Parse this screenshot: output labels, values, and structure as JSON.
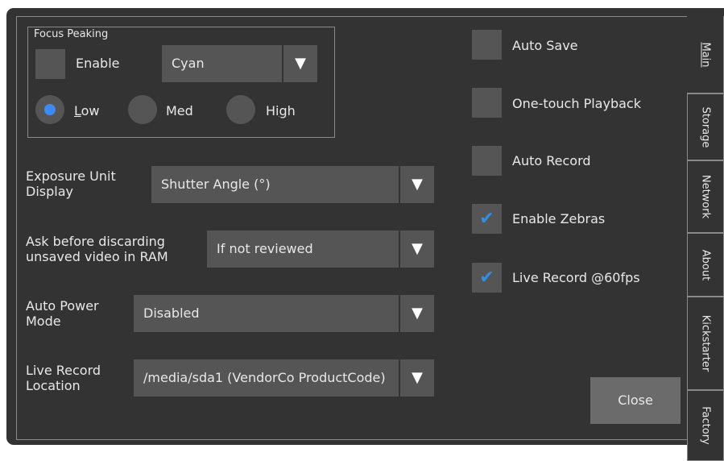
{
  "focus_peaking": {
    "title": "Focus Peaking",
    "enable_label": "Enable",
    "color_value": "Cyan",
    "radio_low_prefix": "",
    "radio_low_underlined": "L",
    "radio_low_rest": "ow",
    "radio_med": "Med",
    "radio_high_prefix": "Hi",
    "radio_high_underlined": "g",
    "radio_high_rest": "h",
    "selected": "Low"
  },
  "settings": {
    "exposure_label_1": "Exposure Unit",
    "exposure_label_2": "Display",
    "exposure_value": "Shutter Angle (°)",
    "discard_label_1": "Ask before discarding",
    "discard_label_2": "unsaved video in RAM",
    "discard_value": "If not reviewed",
    "power_label_1": "Auto Power",
    "power_label_2": "Mode",
    "power_value": "Disabled",
    "location_label_1": "Live Record",
    "location_label_2": "Location",
    "location_value": "/media/sda1 (VendorCo ProductCode)"
  },
  "checkboxes": {
    "auto_save": "Auto Save",
    "one_touch": "One-touch Playback",
    "auto_record": "Auto Record",
    "zebras": "Enable Zebras",
    "live_record": "Live Record @60fps",
    "check_mark": "✔"
  },
  "arrow_glyph": "▼",
  "close_label": "Close",
  "tabs": {
    "main": "Main",
    "storage": "Storage",
    "network": "Network",
    "about": "About",
    "kickstarter": "Kickstarter",
    "factory": "Factory"
  },
  "colors": {
    "background": "#333333",
    "control": "#555555",
    "accent": "#3d8bf2",
    "button": "#6b6b6b"
  }
}
